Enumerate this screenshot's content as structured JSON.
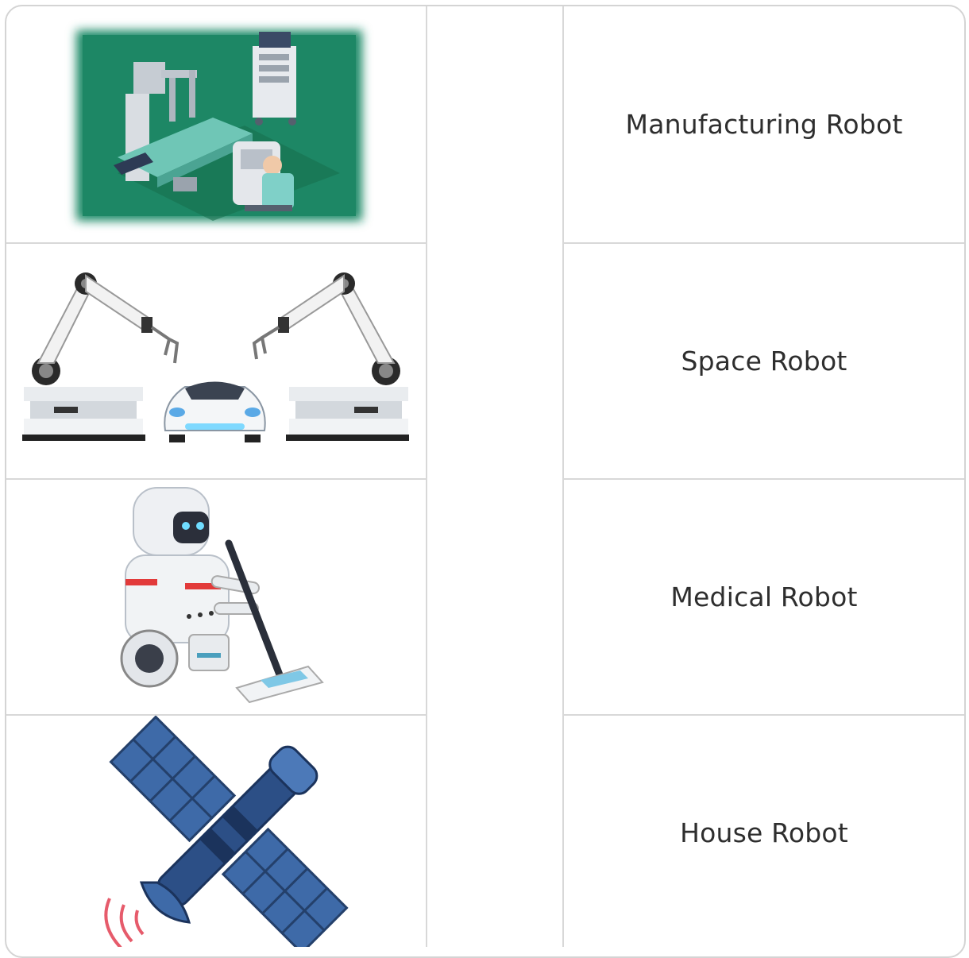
{
  "rows": [
    {
      "image_icon": "surgical-operating-room-icon",
      "label": "Manufacturing Robot"
    },
    {
      "image_icon": "industrial-robot-arms-car-icon",
      "label": "Space Robot"
    },
    {
      "image_icon": "cleaning-robot-mop-icon",
      "label": "Medical Robot"
    },
    {
      "image_icon": "satellite-icon",
      "label": "House Robot"
    }
  ]
}
